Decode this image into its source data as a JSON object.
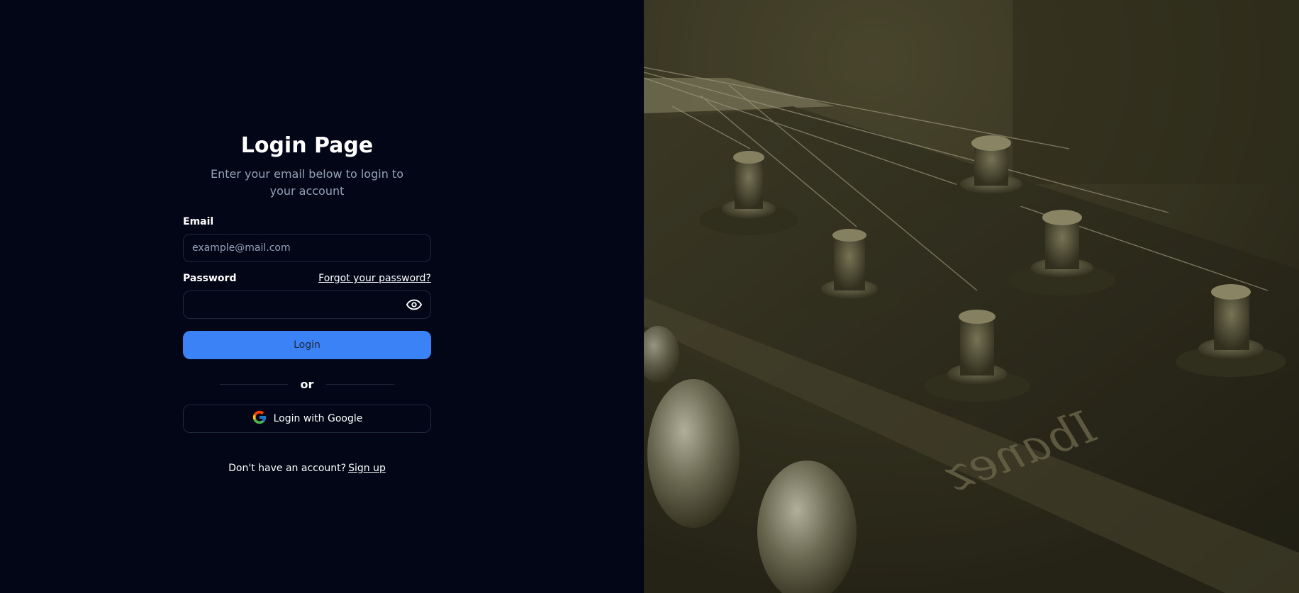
{
  "login": {
    "title": "Login Page",
    "subtitle": "Enter your email below to login to your account",
    "email_label": "Email",
    "email_placeholder": "example@mail.com",
    "email_value": "",
    "password_label": "Password",
    "password_value": "",
    "forgot_link": "Forgot your password?",
    "login_button": "Login",
    "divider_text": "or",
    "google_button": "Login with Google",
    "signup_prompt": "Don't have an account?",
    "signup_link": "Sign up"
  },
  "icons": {
    "password_toggle": "eye-icon",
    "google": "google-logo-icon"
  },
  "colors": {
    "background": "#020617",
    "primary": "#3b82f6",
    "muted_text": "#94a3b8",
    "border": "#1e293b",
    "image_tint": "#3a3823"
  },
  "hero_image": {
    "subject": "guitar headstock photo",
    "brand_lettering": "Ibanez"
  }
}
